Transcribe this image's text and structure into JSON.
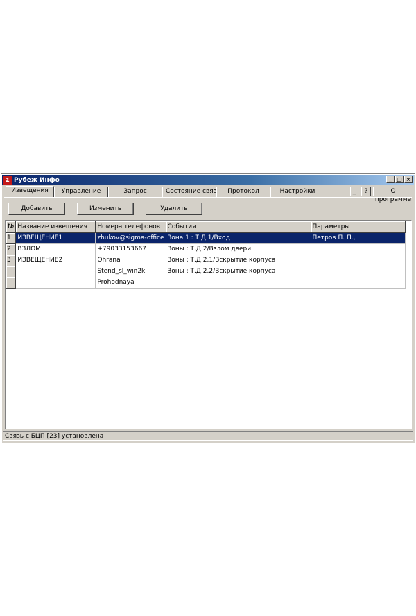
{
  "window": {
    "title": "Рубеж Инфо",
    "icon_glyph": "Σ",
    "controls": {
      "minimize": "_",
      "maximize": "□",
      "close": "×"
    }
  },
  "tabs": [
    "Извещения",
    "Управление",
    "Запрос",
    "Состояние связи",
    "Протокол",
    "Настройки"
  ],
  "help_button": "?",
  "about_button": "О программе",
  "toolbar": {
    "add": "Добавить",
    "edit": "Изменить",
    "delete": "Удалить"
  },
  "table": {
    "headers": [
      "№",
      "Название извещения",
      "Номера телефонов",
      "События",
      "Параметры"
    ],
    "rows": [
      [
        "1",
        "ИЗВЕЩЕНИЕ1",
        "zhukov@sigma-office",
        "Зона 1 : Т.Д.1/Вход",
        "Петров П. П.,"
      ],
      [
        "2",
        "ВЗЛОМ",
        "+79033153667",
        "Зоны : Т.Д.2/Взлом двери",
        ""
      ],
      [
        "3",
        "ИЗВЕЩЕНИЕ2",
        "Ohrana",
        "Зоны : Т.Д.2.1/Вскрытие корпуса",
        ""
      ],
      [
        "",
        "",
        "Stend_sl_win2k",
        "Зоны : Т.Д.2.2/Вскрытие корпуса",
        ""
      ],
      [
        "",
        "",
        "Prohodnaya",
        "",
        ""
      ]
    ],
    "selected_row": 0
  },
  "status": "Связь с БЦП [23] установлена"
}
